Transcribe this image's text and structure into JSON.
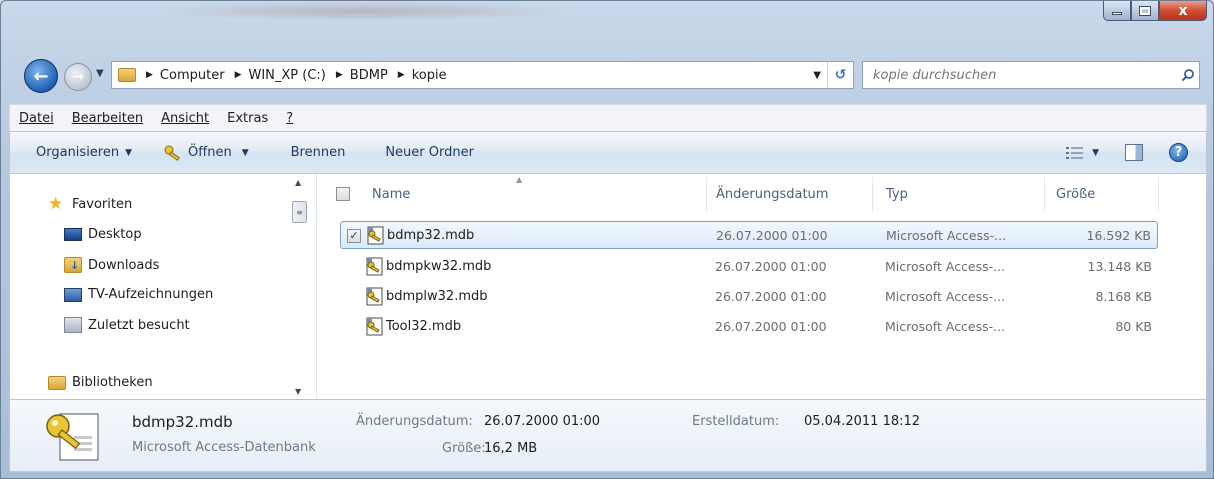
{
  "window": {
    "controls": {
      "minimize": "minimize",
      "maximize": "maximize",
      "close": "x"
    }
  },
  "address": {
    "crumbs": [
      "Computer",
      "WIN_XP (C:)",
      "BDMP",
      "kopie"
    ]
  },
  "search": {
    "placeholder": "kopie durchsuchen"
  },
  "menu": {
    "items": [
      {
        "label": "Datei"
      },
      {
        "label": "Bearbeiten"
      },
      {
        "label": "Ansicht"
      },
      {
        "label": "Extras"
      },
      {
        "label": "?"
      }
    ]
  },
  "toolbar": {
    "organize": "Organisieren",
    "open": "Öffnen",
    "burn": "Brennen",
    "new_folder": "Neuer Ordner"
  },
  "nav": {
    "favorites": "Favoriten",
    "items": [
      "Desktop",
      "Downloads",
      "TV-Aufzeichnungen",
      "Zuletzt besucht"
    ],
    "libraries": "Bibliotheken"
  },
  "columns": {
    "name": "Name",
    "date": "Änderungsdatum",
    "type": "Typ",
    "size": "Größe"
  },
  "files": [
    {
      "name": "bdmp32.mdb",
      "date": "26.07.2000 01:00",
      "type": "Microsoft Access-...",
      "size": "16.592 KB",
      "selected": true
    },
    {
      "name": "bdmpkw32.mdb",
      "date": "26.07.2000 01:00",
      "type": "Microsoft Access-...",
      "size": "13.148 KB",
      "selected": false
    },
    {
      "name": "bdmplw32.mdb",
      "date": "26.07.2000 01:00",
      "type": "Microsoft Access-...",
      "size": "8.168 KB",
      "selected": false
    },
    {
      "name": "Tool32.mdb",
      "date": "26.07.2000 01:00",
      "type": "Microsoft Access-...",
      "size": "80 KB",
      "selected": false
    }
  ],
  "details": {
    "filename": "bdmp32.mdb",
    "filetype": "Microsoft Access-Datenbank",
    "modified_label": "Änderungsdatum:",
    "modified_value": "26.07.2000 01:00",
    "size_label": "Größe:",
    "size_value": "16,2 MB",
    "created_label": "Erstelldatum:",
    "created_value": "05.04.2011 18:12"
  },
  "icons": {
    "back": "back-arrow-icon",
    "forward": "forward-arrow-icon",
    "search": "search-icon",
    "refresh": "refresh-icon",
    "help": "help-icon",
    "file": "access-database-icon"
  },
  "colors": {
    "selection_border": "#7da2ce",
    "selection_fill": "#dbebfb",
    "toolbar_text": "#1e395b",
    "close_button": "#cf4f33"
  }
}
